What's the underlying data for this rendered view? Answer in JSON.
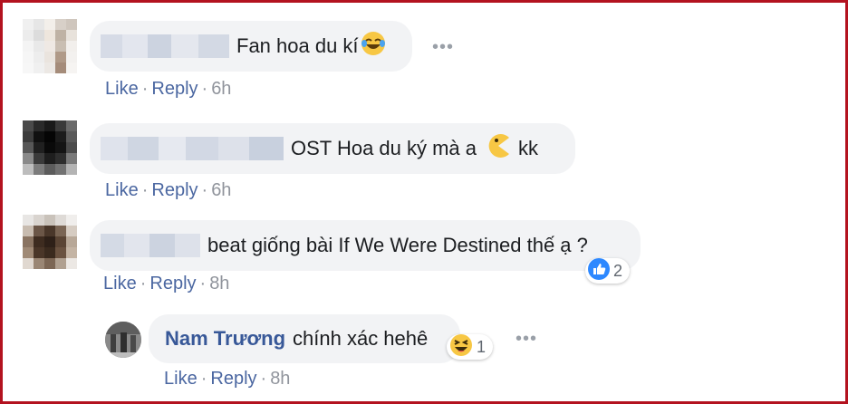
{
  "comments": [
    {
      "text": "Fan hoa du kí",
      "emoji": "laughing-tears-emoji",
      "actions": {
        "like": "Like",
        "reply": "Reply",
        "time": "6h"
      }
    },
    {
      "text": "OST Hoa du ký mà a",
      "emoji": "pacman-emoji",
      "text_after": "kk",
      "actions": {
        "like": "Like",
        "reply": "Reply",
        "time": "6h"
      }
    },
    {
      "text": "beat giống bài If We Were Destined thế ạ ?",
      "actions": {
        "like": "Like",
        "reply": "Reply",
        "time": "8h"
      },
      "reaction": {
        "icon": "like-icon",
        "count": "2"
      }
    }
  ],
  "reply": {
    "author": "Nam Trương",
    "text": "chính xác hehê",
    "actions": {
      "like": "Like",
      "reply": "Reply",
      "time": "8h"
    },
    "reaction": {
      "icon": "haha-emoji",
      "count": "1"
    }
  },
  "more_label": "•••",
  "colors": {
    "link": "#4b67a1",
    "author": "#385898",
    "bubble": "#f2f3f5",
    "frame": "#b3121f",
    "reaction_like": "#2d88ff"
  }
}
